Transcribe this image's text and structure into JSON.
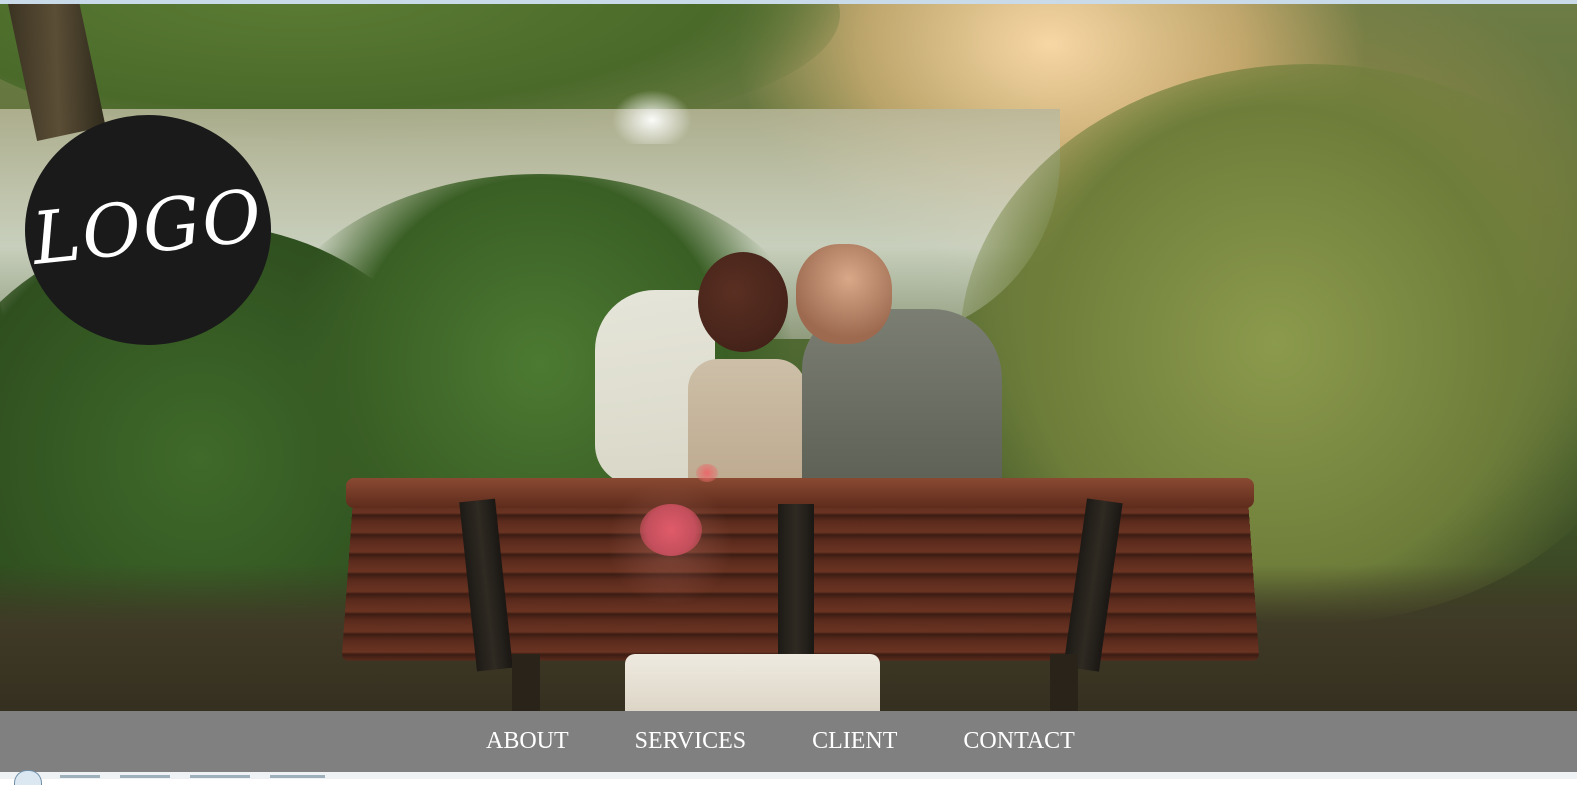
{
  "logo": {
    "text": "LOGO"
  },
  "nav": {
    "items": [
      {
        "label": "ABOUT"
      },
      {
        "label": "SERVICES"
      },
      {
        "label": "CLIENT"
      },
      {
        "label": "CONTACT"
      }
    ]
  },
  "colors": {
    "nav_background": "#808080",
    "nav_text": "#ffffff",
    "logo_background": "#1a1a1a",
    "logo_text": "#ffffff"
  },
  "hero": {
    "image_subject": "couple-on-bench-by-pond"
  }
}
